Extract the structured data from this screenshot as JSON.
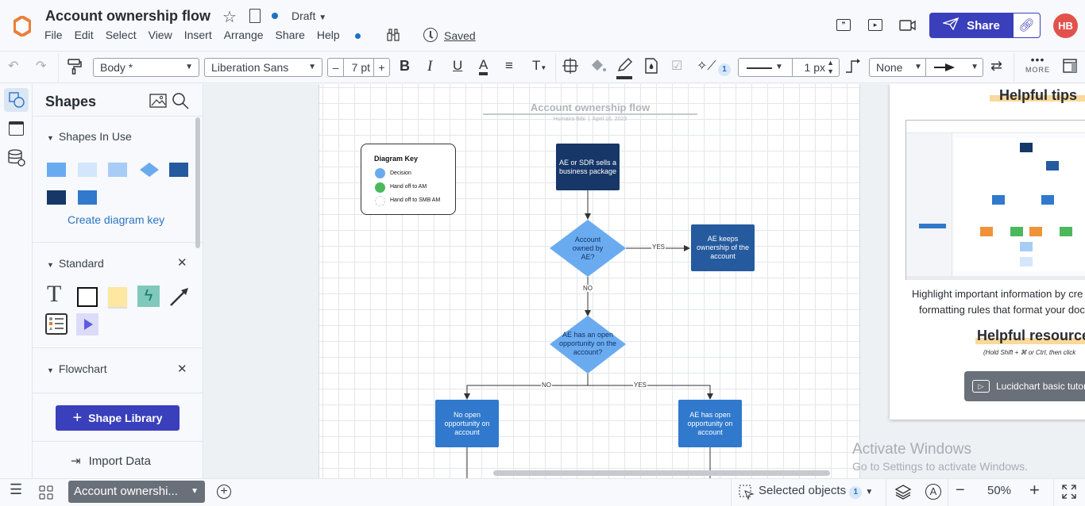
{
  "header": {
    "doc_title": "Account ownership flow",
    "status": "Draft",
    "menu": [
      "File",
      "Edit",
      "Select",
      "View",
      "Insert",
      "Arrange",
      "Share",
      "Help"
    ],
    "saved_label": "Saved",
    "share_label": "Share",
    "avatar_initials": "HB",
    "accent_color": "#3a3fbb",
    "avatar_color": "#e2524b"
  },
  "toolbar": {
    "style_select": "Body *",
    "font_select": "Liberation Sans",
    "font_size": "7 pt",
    "minus": "–",
    "plus": "+",
    "line_width": "1 px",
    "line_start": "None",
    "more_label": "MORE",
    "magic_badge": "1"
  },
  "shapes_panel": {
    "title": "Shapes",
    "sections": [
      {
        "label": "Shapes In Use"
      },
      {
        "label": "Standard"
      },
      {
        "label": "Flowchart"
      }
    ],
    "in_use_colors": [
      "#6aabf0",
      "#d4e6fb",
      "#a7cdf6",
      "#6aabf0",
      "#255a9e",
      "#163768",
      "#3079cc"
    ],
    "create_key_label": "Create diagram key",
    "shape_library_label": "Shape Library",
    "import_label": "Import Data"
  },
  "diagram": {
    "title": "Account ownership flow",
    "author": "Humaira Bibi",
    "date": "April 16, 2023",
    "key": {
      "title": "Diagram Key",
      "items": [
        {
          "label": "Decision",
          "color": "#6aabf0"
        },
        {
          "label": "Hand off to AM",
          "color": "#4cb85c"
        },
        {
          "label": "Hand off to SMB AM",
          "color": "#ffffff"
        }
      ]
    },
    "nodes": {
      "start": "AE or SDR sells a business package",
      "decision1": "Account owned by AE?",
      "keeps": "AE keeps ownership of the account",
      "decision2": "AE has an open opportunity on the account?",
      "no_opp": "No open opportunity on account",
      "has_opp": "AE has open opportunity on account"
    },
    "edges": {
      "yes1": "YES",
      "no1": "NO",
      "no2": "NO",
      "yes2": "YES"
    }
  },
  "tips": {
    "heading1": "Helpful tips",
    "text1": "Highlight important information by cre",
    "text2": "formatting rules that format your doc",
    "heading2": "Helpful resource",
    "hint": "(Hold Shift + ⌘ or Ctrl, then click",
    "tutorial_label": "Lucidchart basic tutoria"
  },
  "watermark": {
    "line1": "Activate Windows",
    "line2": "Go to Settings to activate Windows."
  },
  "bottom": {
    "page_tab": "Account ownershi...",
    "selected_label": "Selected objects",
    "selected_count": "1",
    "zoom": "50%"
  }
}
